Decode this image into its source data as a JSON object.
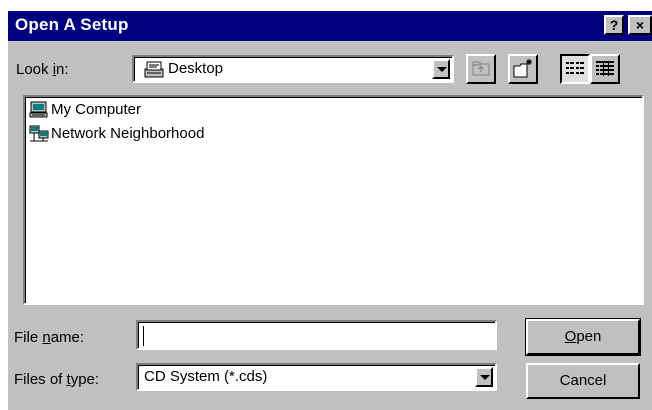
{
  "dialog": {
    "title": "Open A Setup",
    "help_button": "?",
    "close_button": "×"
  },
  "look_in": {
    "label_prefix": "Look ",
    "label_accel": "i",
    "label_suffix": "n:",
    "value": "Desktop"
  },
  "toolbar": {
    "buttons": [
      {
        "name": "up-one-level",
        "icon": "folder-up-icon"
      },
      {
        "name": "create-new-folder",
        "icon": "new-folder-icon"
      },
      {
        "name": "list-view",
        "icon": "list-view-icon",
        "pressed": true
      },
      {
        "name": "details-view",
        "icon": "details-view-icon"
      }
    ]
  },
  "file_list": {
    "items": [
      {
        "label": "My Computer",
        "icon": "computer-icon"
      },
      {
        "label": "Network Neighborhood",
        "icon": "network-icon"
      }
    ]
  },
  "file_name": {
    "label_prefix": "File ",
    "label_accel": "n",
    "label_suffix": "ame:",
    "value": ""
  },
  "file_type": {
    "label_prefix": "Files of ",
    "label_accel": "t",
    "label_suffix": "ype:",
    "value": "CD System  (*.cds)"
  },
  "buttons": {
    "open_accel": "O",
    "open_rest": "pen",
    "cancel": "Cancel"
  },
  "colors": {
    "title_bar": "#000080",
    "face": "#c0c0c0"
  }
}
